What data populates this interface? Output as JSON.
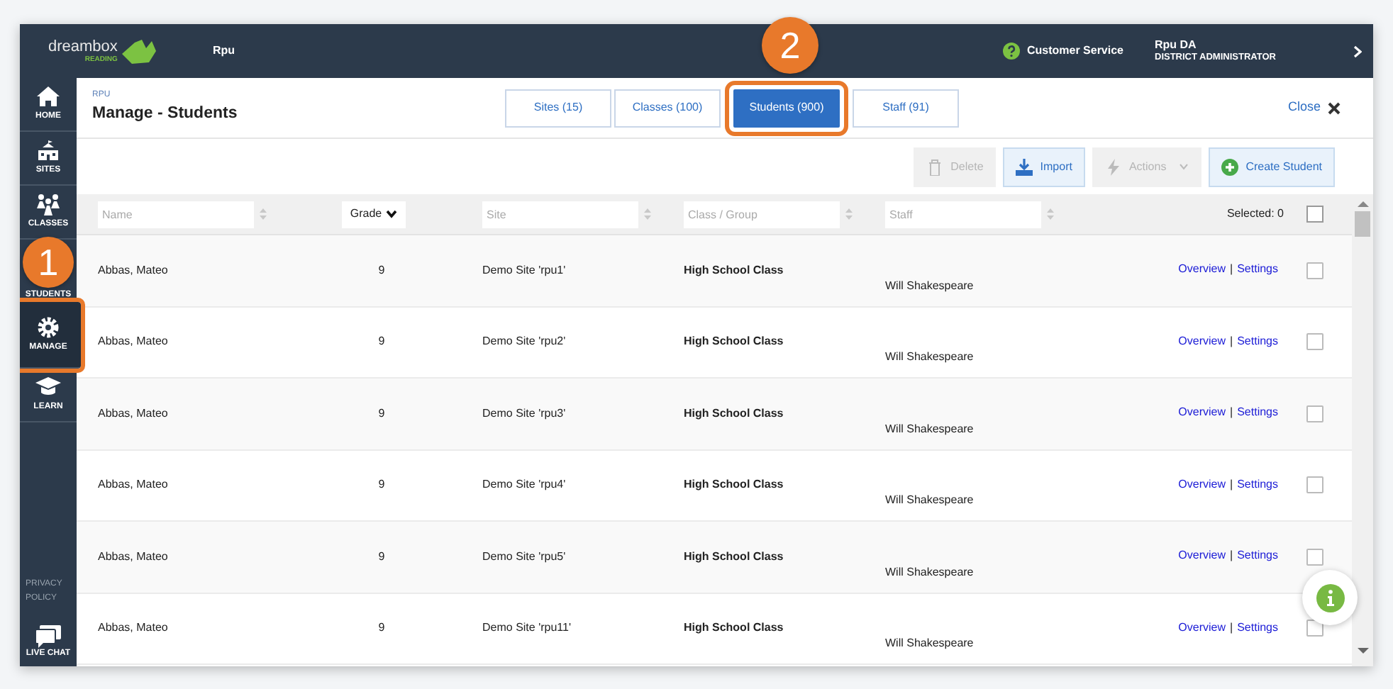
{
  "header": {
    "logo_wordmark": "dreambox",
    "logo_subtitle": "READING",
    "district": "Rpu",
    "help_label": "Customer Service",
    "user_name": "Rpu DA",
    "user_role": "DISTRICT ADMINISTRATOR"
  },
  "sidebar": {
    "items": [
      {
        "label": "HOME",
        "kind": "home",
        "highlighted": false
      },
      {
        "label": "SITES",
        "kind": "school",
        "highlighted": false
      },
      {
        "label": "CLASSES",
        "kind": "people",
        "highlighted": false
      },
      {
        "label": "STUDENTS",
        "kind": "hidden",
        "highlighted": false
      },
      {
        "label": "MANAGE",
        "kind": "gear",
        "highlighted": true
      },
      {
        "label": "LEARN",
        "kind": "cap",
        "highlighted": false
      }
    ],
    "privacy": "PRIVACY POLICY",
    "live_chat": "LIVE CHAT"
  },
  "page": {
    "breadcrumb": "RPU",
    "title": "Manage - Students",
    "close": "Close"
  },
  "tabs": [
    {
      "label": "Sites (15)",
      "selected": false,
      "highlighted": false
    },
    {
      "label": "Classes (100)",
      "selected": false,
      "highlighted": false
    },
    {
      "label": "Students (900)",
      "selected": true,
      "highlighted": true
    },
    {
      "label": "Staff (91)",
      "selected": false,
      "highlighted": false
    }
  ],
  "toolbar": [
    {
      "label": "Delete",
      "kind": "delete",
      "disabled": true
    },
    {
      "label": "Import",
      "kind": "import",
      "disabled": false
    },
    {
      "label": "Actions",
      "kind": "actions",
      "disabled": true
    },
    {
      "label": "Create Student",
      "kind": "create",
      "disabled": false
    }
  ],
  "table": {
    "columns": [
      {
        "kind": "filter",
        "placeholder": "Name"
      },
      {
        "kind": "sort",
        "label": "Grade"
      },
      {
        "kind": "filter",
        "placeholder": "Site"
      },
      {
        "kind": "filter",
        "placeholder": "Class / Group"
      },
      {
        "kind": "filter",
        "placeholder": "Staff"
      }
    ],
    "selected_label": "Selected: 0",
    "select_all_checked": false,
    "rows": [
      {
        "name": "Abbas, Mateo",
        "grade": "9",
        "site": "Demo Site 'rpu1'",
        "class": "High School Class",
        "staff": "Will Shakespeare",
        "overview": "Overview",
        "divider": "|",
        "settings": "Settings",
        "checked": false
      },
      {
        "name": "Abbas, Mateo",
        "grade": "9",
        "site": "Demo Site 'rpu2'",
        "class": "High School Class",
        "staff": "Will Shakespeare",
        "overview": "Overview",
        "divider": "|",
        "settings": "Settings",
        "checked": false
      },
      {
        "name": "Abbas, Mateo",
        "grade": "9",
        "site": "Demo Site 'rpu3'",
        "class": "High School Class",
        "staff": "Will Shakespeare",
        "overview": "Overview",
        "divider": "|",
        "settings": "Settings",
        "checked": false
      },
      {
        "name": "Abbas, Mateo",
        "grade": "9",
        "site": "Demo Site 'rpu4'",
        "class": "High School Class",
        "staff": "Will Shakespeare",
        "overview": "Overview",
        "divider": "|",
        "settings": "Settings",
        "checked": false
      },
      {
        "name": "Abbas, Mateo",
        "grade": "9",
        "site": "Demo Site 'rpu5'",
        "class": "High School Class",
        "staff": "Will Shakespeare",
        "overview": "Overview",
        "divider": "|",
        "settings": "Settings",
        "checked": false
      },
      {
        "name": "Abbas, Mateo",
        "grade": "9",
        "site": "Demo Site 'rpu11'",
        "class": "High School Class",
        "staff": "Will Shakespeare",
        "overview": "Overview",
        "divider": "|",
        "settings": "Settings",
        "checked": false
      }
    ]
  },
  "callouts": [
    {
      "label": "1"
    },
    {
      "label": "2"
    }
  ]
}
